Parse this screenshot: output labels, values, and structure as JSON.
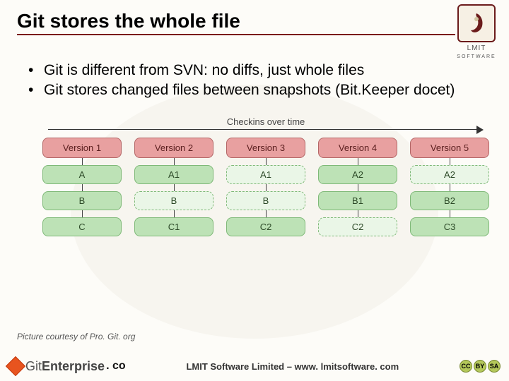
{
  "slide": {
    "title": "Git stores the whole file",
    "bullets": [
      "Git is different from SVN: no diffs, just whole files",
      "Git stores changed files between snapshots (Bit.Keeper docet)"
    ],
    "picture_credit": "Picture courtesy of  Pro. Git. org"
  },
  "diagram": {
    "axis_label": "Checkins over time",
    "versions": [
      "Version 1",
      "Version 2",
      "Version 3",
      "Version 4",
      "Version 5"
    ],
    "rows": [
      [
        {
          "label": "A",
          "dashed": false
        },
        {
          "label": "A1",
          "dashed": false
        },
        {
          "label": "A1",
          "dashed": true
        },
        {
          "label": "A2",
          "dashed": false
        },
        {
          "label": "A2",
          "dashed": true
        }
      ],
      [
        {
          "label": "B",
          "dashed": false
        },
        {
          "label": "B",
          "dashed": true
        },
        {
          "label": "B",
          "dashed": true
        },
        {
          "label": "B1",
          "dashed": false
        },
        {
          "label": "B2",
          "dashed": false
        }
      ],
      [
        {
          "label": "C",
          "dashed": false
        },
        {
          "label": "C1",
          "dashed": false
        },
        {
          "label": "C2",
          "dashed": false
        },
        {
          "label": "C2",
          "dashed": true
        },
        {
          "label": "C3",
          "dashed": false
        }
      ]
    ]
  },
  "logo": {
    "name": "LMIT",
    "sub": "SOFTWARE"
  },
  "footer": {
    "brand_git": "Git",
    "brand_ent": "Enterprise",
    "brand_suffix": ". co",
    "company": "LMIT Software Limited – www. lmitsoftware. com",
    "cc": [
      "CC",
      "BY",
      "SA"
    ]
  }
}
